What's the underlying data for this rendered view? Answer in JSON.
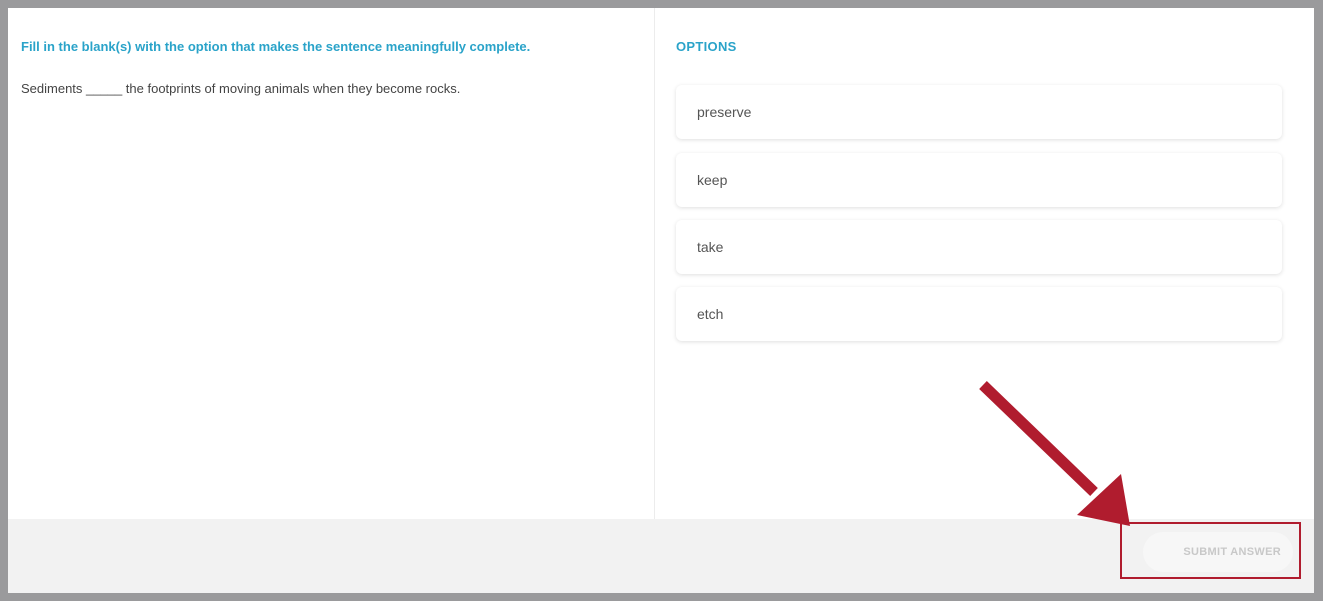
{
  "question": {
    "instruction": "Fill in the blank(s) with the option that makes the sentence meaningfully complete.",
    "sentence": "Sediments _____ the footprints of moving animals when they become rocks."
  },
  "options": {
    "title": "OPTIONS",
    "items": [
      {
        "label": "preserve"
      },
      {
        "label": "keep"
      },
      {
        "label": "take"
      },
      {
        "label": "etch"
      }
    ]
  },
  "footer": {
    "submit_label": "SUBMIT ANSWER"
  },
  "annotation": {
    "arrow_color": "#b01c2e",
    "accent_color": "#2aa3c9"
  }
}
